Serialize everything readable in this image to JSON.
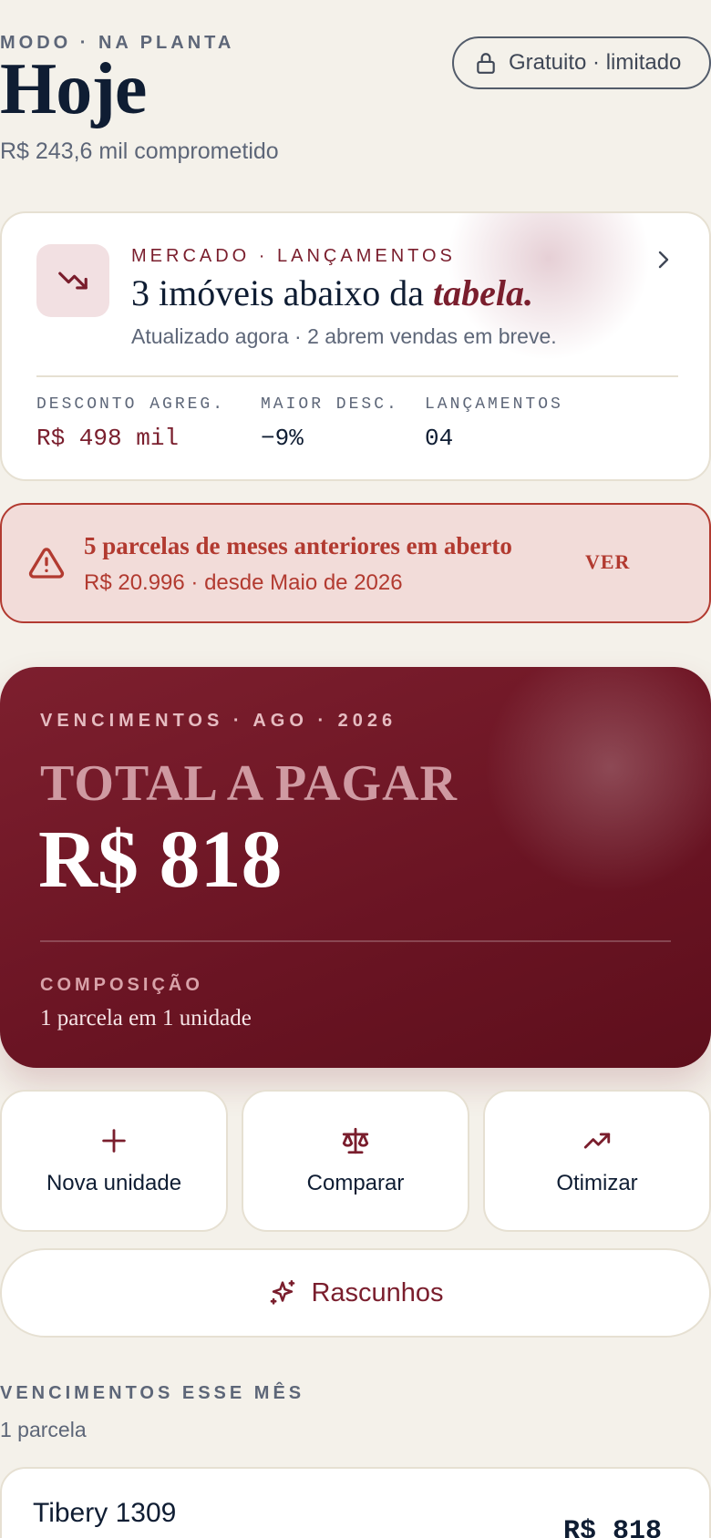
{
  "header": {
    "eyebrow": "MODO · NA PLANTA",
    "title": "Hoje",
    "subtitle": "R$ 243,6 mil comprometido",
    "plan_badge": "Gratuito · limitado"
  },
  "market": {
    "eyebrow": "MERCADO · LANÇAMENTOS",
    "headline_prefix": "3 imóveis abaixo da ",
    "headline_emphasis": "tabela.",
    "note": "Atualizado agora · 2 abrem vendas em breve.",
    "stats": [
      {
        "label": "DESCONTO AGREG.",
        "value": "R$ 498 mil"
      },
      {
        "label": "MAIOR DESC.",
        "value": "−9%"
      },
      {
        "label": "LANÇAMENTOS",
        "value": "04"
      }
    ],
    "icon": "trending-down-icon"
  },
  "alert": {
    "title": "5 parcelas de meses anteriores em aberto",
    "subtitle": "R$ 20.996 · desde Maio de 2026",
    "action": "VER",
    "icon": "warning-icon"
  },
  "hero": {
    "eyebrow": "VENCIMENTOS · AGO · 2026",
    "label": "TOTAL A PAGAR",
    "total": "R$ 818",
    "composition_label": "COMPOSIÇÃO",
    "composition_value": "1 parcela em 1 unidade"
  },
  "actions": [
    {
      "label": "Nova unidade",
      "icon": "plus-icon"
    },
    {
      "label": "Comparar",
      "icon": "scale-icon"
    },
    {
      "label": "Otimizar",
      "icon": "trending-up-icon"
    }
  ],
  "drafts": {
    "label": "Rascunhos",
    "icon": "sparkles-icon"
  },
  "due_section": {
    "title": "VENCIMENTOS ESSE MÊS",
    "count": "1 parcela",
    "items": [
      {
        "name": "Tibery 1309",
        "amount": "R$ 818"
      }
    ]
  },
  "colors": {
    "background": "#f4f1ea",
    "accent": "#7a1e2d",
    "alert": "#b23a30",
    "text": "#0f1d33",
    "muted": "#5d6678"
  }
}
